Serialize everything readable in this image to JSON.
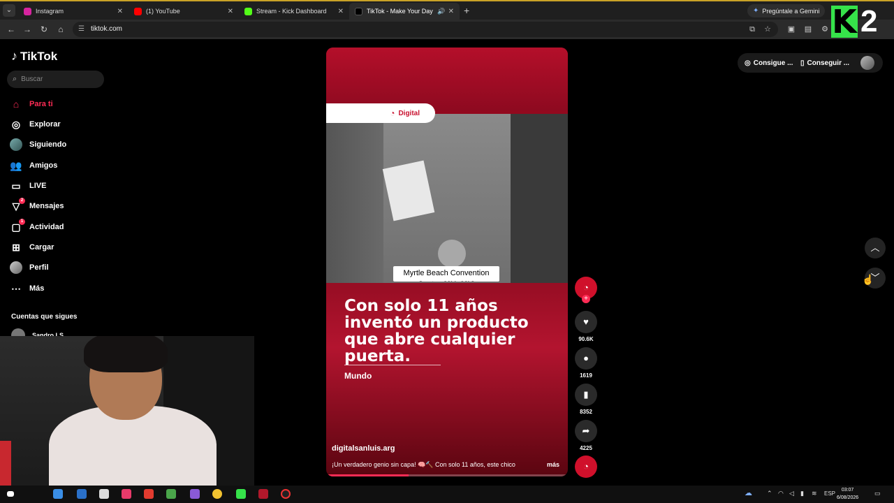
{
  "browser": {
    "tabs": [
      {
        "title": "Instagram",
        "favicon_color": "#d6249f",
        "active": false
      },
      {
        "title": "(1) YouTube",
        "favicon_color": "#ff0000",
        "active": false
      },
      {
        "title": "Stream - Kick Dashboard",
        "favicon_color": "#53fc18",
        "active": false
      },
      {
        "title": "TikTok - Make Your Day",
        "favicon_color": "#000000",
        "active": true
      }
    ],
    "gemini_label": "Pregúntale a Gemini",
    "url": "tiktok.com"
  },
  "overlay_logo": {
    "letter": "K",
    "number": "2",
    "color": "#36e24a"
  },
  "tiktok": {
    "brand": "TikTok",
    "search_placeholder": "Buscar",
    "nav": [
      {
        "label": "Para ti",
        "icon": "home-icon",
        "active": true
      },
      {
        "label": "Explorar",
        "icon": "compass-icon"
      },
      {
        "label": "Siguiendo",
        "icon": "avatar-icon"
      },
      {
        "label": "Amigos",
        "icon": "friends-icon"
      },
      {
        "label": "LIVE",
        "icon": "live-icon"
      },
      {
        "label": "Mensajes",
        "icon": "messages-icon",
        "badge": "2"
      },
      {
        "label": "Actividad",
        "icon": "activity-icon",
        "badge": "1"
      },
      {
        "label": "Cargar",
        "icon": "upload-icon"
      },
      {
        "label": "Perfil",
        "icon": "profile-icon"
      },
      {
        "label": "Más",
        "icon": "more-icon"
      }
    ],
    "following_heading": "Cuentas que sigues",
    "following": [
      {
        "name": "Sandro LS"
      }
    ],
    "header": {
      "get_coins": "Consigue ...",
      "get_app": "Conseguir ..."
    }
  },
  "video": {
    "brand": "Digital",
    "caption": "Myrtle Beach Convention Center 6/11-6/13",
    "headline": "Con solo 11 años inventó un producto que abre cualquier puerta.",
    "tag": "Mundo",
    "author": "digitalsanluis.arg",
    "description": "¡Un verdadero genio sin capa! 🧠🔨 Con solo 11 años, este chico",
    "more": "más",
    "progress_fraction": 0.34
  },
  "actions": {
    "likes": "90.6K",
    "comments": "1619",
    "saves": "8352",
    "shares": "4225"
  },
  "taskbar": {
    "language": "ESP",
    "time": "03:07",
    "date": "6/08/2026"
  }
}
